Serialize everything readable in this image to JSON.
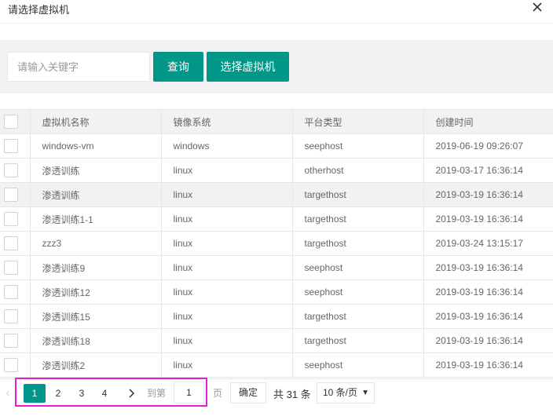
{
  "dialog": {
    "title": "请选择虚拟机",
    "close_icon": "close-icon"
  },
  "toolbar": {
    "search_placeholder": "请输入关键字",
    "search_value": "",
    "query_label": "查询",
    "select_label": "选择虚拟机"
  },
  "table": {
    "columns": [
      "虚拟机名称",
      "镜像系统",
      "平台类型",
      "创建时间"
    ],
    "rows": [
      {
        "name": "windows-vm",
        "image": "windows",
        "platform": "seephost",
        "created": "2019-06-19 09:26:07"
      },
      {
        "name": "渗透训练",
        "image": "linux",
        "platform": "otherhost",
        "created": "2019-03-17 16:36:14"
      },
      {
        "name": "渗透训练",
        "image": "linux",
        "platform": "targethost",
        "created": "2019-03-19 16:36:14"
      },
      {
        "name": "渗透训练1-1",
        "image": "linux",
        "platform": "targethost",
        "created": "2019-03-19 16:36:14"
      },
      {
        "name": "zzz3",
        "image": "linux",
        "platform": "targethost",
        "created": "2019-03-24 13:15:17"
      },
      {
        "name": "渗透训练9",
        "image": "linux",
        "platform": "seephost",
        "created": "2019-03-19 16:36:14"
      },
      {
        "name": "渗透训练12",
        "image": "linux",
        "platform": "seephost",
        "created": "2019-03-19 16:36:14"
      },
      {
        "name": "渗透训练15",
        "image": "linux",
        "platform": "targethost",
        "created": "2019-03-19 16:36:14"
      },
      {
        "name": "渗透训练18",
        "image": "linux",
        "platform": "targethost",
        "created": "2019-03-19 16:36:14"
      },
      {
        "name": "渗透训练2",
        "image": "linux",
        "platform": "seephost",
        "created": "2019-03-19 16:36:14"
      }
    ],
    "highlighted_row": 2
  },
  "pagination": {
    "pages": [
      "1",
      "2",
      "3",
      "4"
    ],
    "current": "1",
    "goto_prefix": "到第",
    "goto_value": "1",
    "goto_suffix": "页",
    "confirm_label": "确定",
    "total_label": "共 31 条",
    "page_size": "10 条/页",
    "prev_icon": "chevron-left-icon",
    "next_icon": "chevron-right-icon"
  },
  "colors": {
    "accent": "#009688",
    "annotation": "#e91ed4"
  }
}
